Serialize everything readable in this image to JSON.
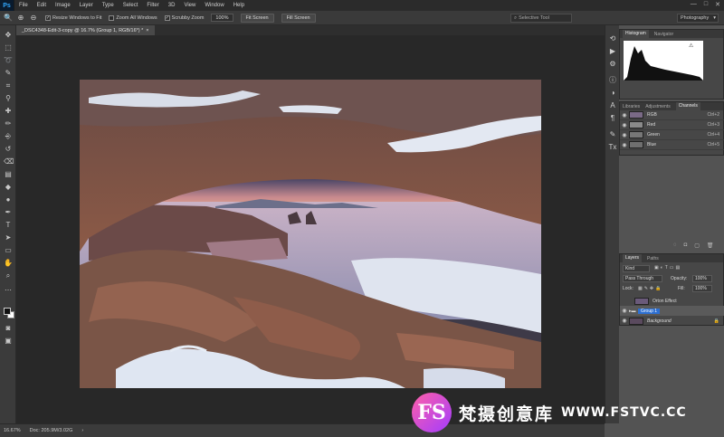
{
  "app": {
    "logo": "Ps"
  },
  "menu": [
    "File",
    "Edit",
    "Image",
    "Layer",
    "Type",
    "Select",
    "Filter",
    "3D",
    "View",
    "Window",
    "Help"
  ],
  "window_controls": [
    "—",
    "□",
    "✕"
  ],
  "options": {
    "resize_label": "Resize Windows to Fit",
    "zoom_all_label": "Zoom All Windows",
    "scrubby_label": "Scrubby Zoom",
    "zoom_value": "100%",
    "fit_screen": "Fit Screen",
    "fill_screen": "Fill Screen"
  },
  "search": {
    "text": "Selective Tool"
  },
  "workspace": {
    "value": "Photography"
  },
  "document": {
    "tab_title": "_DSC4348-Edit-3-copy @ 16.7% (Group 1, RGB/16*) *",
    "close": "×"
  },
  "status": {
    "zoom": "16.67%",
    "doc": "Doc: 205.9M/3.02G"
  },
  "panels": {
    "histogram_tabs": [
      "Histogram",
      "Navigator"
    ],
    "channels_tabs": [
      "Libraries",
      "Adjustments",
      "Channels"
    ],
    "channels": [
      {
        "name": "RGB",
        "shortcut": "Ctrl+2"
      },
      {
        "name": "Red",
        "shortcut": "Ctrl+3"
      },
      {
        "name": "Green",
        "shortcut": "Ctrl+4"
      },
      {
        "name": "Blue",
        "shortcut": "Ctrl+5"
      }
    ],
    "layers_tabs": [
      "Layers",
      "Paths"
    ],
    "kind": "Kind",
    "blend_mode": "Pass Through",
    "opacity_label": "Opacity:",
    "opacity_value": "100%",
    "lock_label": "Lock:",
    "fill_label": "Fill:",
    "fill_value": "100%",
    "layers": [
      {
        "name": "Orton Effect"
      },
      {
        "name": "Group 1"
      },
      {
        "name": "Background"
      }
    ]
  },
  "watermark": {
    "logo": "FS",
    "text_cn": "梵摄创意库",
    "url": "WWW.FSTVC.CC"
  },
  "colors": {
    "accent": "#31a8ff",
    "sky": "#e8a08a",
    "rock": "#8a5a48",
    "snow": "#e4ecf5"
  }
}
